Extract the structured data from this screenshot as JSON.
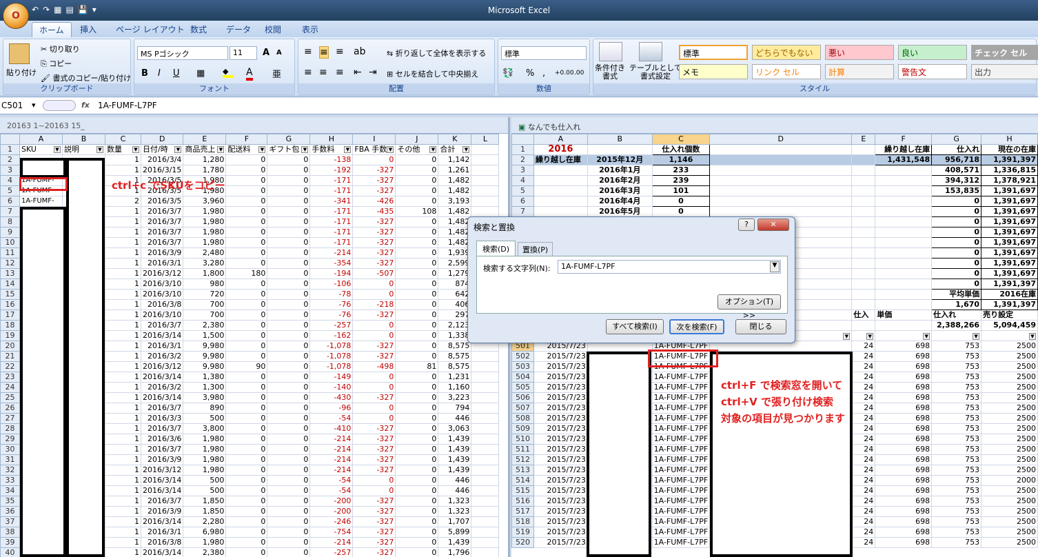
{
  "app_title": "Microsoft Excel",
  "office_button": "O",
  "qat": [
    "↶",
    "↷",
    "▦",
    "▤",
    "💾",
    "▾"
  ],
  "ribbon_tabs": [
    "ホーム",
    "挿入",
    "ページ レイアウト",
    "数式",
    "データ",
    "校閲",
    "表示"
  ],
  "clipboard": {
    "paste": "貼り付け",
    "cut": "切り取り",
    "copy": "コピー",
    "format_painter": "書式のコピー/貼り付け",
    "label": "クリップボード"
  },
  "font": {
    "name": "MS Pゴシック",
    "size": "11",
    "label": "フォント",
    "bold": "B",
    "italic": "I",
    "underline": "U",
    "grow": "A",
    "shrink": "A",
    "phonetic": "亜"
  },
  "alignment": {
    "wrap": "折り返して全体を表示する",
    "merge": "セルを結合して中央揃え",
    "label": "配置"
  },
  "number": {
    "format": "標準",
    "label": "数値",
    "percent": "%",
    "comma": ",",
    "inc": "+0.00",
    "dec": ".00"
  },
  "styles": {
    "conditional": "条件付き\n書式",
    "table": "テーブルとして\n書式設定",
    "label": "スタイル",
    "cells": [
      "標準",
      "どちらでもない",
      "悪い",
      "良い",
      "チェック セル",
      "メモ",
      "リンク セル",
      "計算",
      "警告文",
      "出力"
    ]
  },
  "formula_bar": {
    "name_box": "C501",
    "fx": "fx",
    "content": "1A-FUMF-L7PF"
  },
  "left_window": {
    "title": "20163 1~20163 15_",
    "cols": [
      "A",
      "B",
      "C",
      "D",
      "E",
      "F",
      "G",
      "H",
      "I",
      "J",
      "K",
      "L"
    ],
    "headers": [
      "SKU",
      "説明",
      "数量",
      "日付/時",
      "商品売上",
      "配送料",
      "ギフト包",
      "手数料",
      "FBA 手数",
      "その他",
      "合計"
    ],
    "rows": [
      [
        "2",
        "",
        "",
        "1",
        "2016/3/4",
        "1,280",
        "0",
        "0",
        "-138",
        "0",
        "0",
        "1,142"
      ],
      [
        "3",
        "",
        "",
        "1",
        "2016/3/15",
        "1,780",
        "0",
        "0",
        "-192",
        "-327",
        "0",
        "1,261"
      ],
      [
        "4",
        "1A-FUMF-",
        "",
        "1",
        "2016/3/5",
        "1,980",
        "0",
        "0",
        "-171",
        "-327",
        "0",
        "1,482"
      ],
      [
        "5",
        "1A-FUMF-",
        "",
        "1",
        "2016/3/5",
        "1,980",
        "0",
        "0",
        "-171",
        "-327",
        "0",
        "1,482"
      ],
      [
        "6",
        "1A-FUMF-",
        "",
        "2",
        "2016/3/5",
        "3,960",
        "0",
        "0",
        "-341",
        "-426",
        "0",
        "3,193"
      ],
      [
        "7",
        "",
        "",
        "1",
        "2016/3/7",
        "1,980",
        "0",
        "0",
        "-171",
        "-435",
        "108",
        "1,482"
      ],
      [
        "8",
        "",
        "",
        "1",
        "2016/3/7",
        "1,980",
        "0",
        "0",
        "-171",
        "-327",
        "0",
        "1,482"
      ],
      [
        "9",
        "",
        "",
        "1",
        "2016/3/7",
        "1,980",
        "0",
        "0",
        "-171",
        "-327",
        "0",
        "1,482"
      ],
      [
        "10",
        "",
        "",
        "1",
        "2016/3/7",
        "1,980",
        "0",
        "0",
        "-171",
        "-327",
        "0",
        "1,482"
      ],
      [
        "11",
        "",
        "",
        "1",
        "2016/3/9",
        "2,480",
        "0",
        "0",
        "-214",
        "-327",
        "0",
        "1,939"
      ],
      [
        "12",
        "",
        "",
        "1",
        "2016/3/1",
        "3,280",
        "0",
        "0",
        "-354",
        "-327",
        "0",
        "2,599"
      ],
      [
        "13",
        "",
        "",
        "1",
        "2016/3/12",
        "1,800",
        "180",
        "0",
        "-194",
        "-507",
        "0",
        "1,279"
      ],
      [
        "14",
        "",
        "",
        "1",
        "2016/3/10",
        "980",
        "0",
        "0",
        "-106",
        "0",
        "0",
        "874"
      ],
      [
        "15",
        "",
        "",
        "1",
        "2016/3/10",
        "720",
        "0",
        "0",
        "-78",
        "0",
        "0",
        "642"
      ],
      [
        "16",
        "",
        "",
        "1",
        "2016/3/8",
        "700",
        "0",
        "0",
        "-76",
        "-218",
        "0",
        "406"
      ],
      [
        "17",
        "",
        "",
        "1",
        "2016/3/10",
        "700",
        "0",
        "0",
        "-76",
        "-327",
        "0",
        "297"
      ],
      [
        "18",
        "",
        "",
        "1",
        "2016/3/7",
        "2,380",
        "0",
        "0",
        "-257",
        "0",
        "0",
        "2,123"
      ],
      [
        "19",
        "",
        "",
        "1",
        "2016/3/14",
        "1,500",
        "0",
        "0",
        "-162",
        "0",
        "0",
        "1,338"
      ],
      [
        "20",
        "",
        "",
        "1",
        "2016/3/1",
        "9,980",
        "0",
        "0",
        "-1,078",
        "-327",
        "0",
        "8,575"
      ],
      [
        "21",
        "",
        "",
        "1",
        "2016/3/2",
        "9,980",
        "0",
        "0",
        "-1,078",
        "-327",
        "0",
        "8,575"
      ],
      [
        "22",
        "",
        "",
        "1",
        "2016/3/12",
        "9,980",
        "90",
        "0",
        "-1,078",
        "-498",
        "81",
        "8,575"
      ],
      [
        "23",
        "",
        "",
        "1",
        "2016/3/14",
        "1,380",
        "0",
        "0",
        "-149",
        "0",
        "0",
        "1,231"
      ],
      [
        "24",
        "",
        "",
        "1",
        "2016/3/2",
        "1,300",
        "0",
        "0",
        "-140",
        "0",
        "0",
        "1,160"
      ],
      [
        "25",
        "",
        "",
        "1",
        "2016/3/14",
        "3,980",
        "0",
        "0",
        "-430",
        "-327",
        "0",
        "3,223"
      ],
      [
        "26",
        "",
        "",
        "1",
        "2016/3/7",
        "890",
        "0",
        "0",
        "-96",
        "0",
        "0",
        "794"
      ],
      [
        "27",
        "",
        "",
        "1",
        "2016/3/3",
        "500",
        "0",
        "0",
        "-54",
        "0",
        "0",
        "446"
      ],
      [
        "28",
        "",
        "",
        "1",
        "2016/3/7",
        "3,800",
        "0",
        "0",
        "-410",
        "-327",
        "0",
        "3,063"
      ],
      [
        "29",
        "",
        "",
        "1",
        "2016/3/6",
        "1,980",
        "0",
        "0",
        "-214",
        "-327",
        "0",
        "1,439"
      ],
      [
        "30",
        "",
        "",
        "1",
        "2016/3/7",
        "1,980",
        "0",
        "0",
        "-214",
        "-327",
        "0",
        "1,439"
      ],
      [
        "31",
        "",
        "",
        "1",
        "2016/3/9",
        "1,980",
        "0",
        "0",
        "-214",
        "-327",
        "0",
        "1,439"
      ],
      [
        "32",
        "",
        "",
        "1",
        "2016/3/12",
        "1,980",
        "0",
        "0",
        "-214",
        "-327",
        "0",
        "1,439"
      ],
      [
        "33",
        "",
        "",
        "1",
        "2016/3/14",
        "500",
        "0",
        "0",
        "-54",
        "0",
        "0",
        "446"
      ],
      [
        "34",
        "",
        "",
        "1",
        "2016/3/14",
        "500",
        "0",
        "0",
        "-54",
        "0",
        "0",
        "446"
      ],
      [
        "35",
        "",
        "",
        "1",
        "2016/3/7",
        "1,850",
        "0",
        "0",
        "-200",
        "-327",
        "0",
        "1,323"
      ],
      [
        "36",
        "",
        "",
        "1",
        "2016/3/9",
        "1,850",
        "0",
        "0",
        "-200",
        "-327",
        "0",
        "1,323"
      ],
      [
        "37",
        "",
        "",
        "1",
        "2016/3/14",
        "2,280",
        "0",
        "0",
        "-246",
        "-327",
        "0",
        "1,707"
      ],
      [
        "38",
        "",
        "",
        "1",
        "2016/3/1",
        "6,980",
        "0",
        "0",
        "-754",
        "-327",
        "0",
        "5,899"
      ],
      [
        "39",
        "",
        "",
        "1",
        "2016/3/8",
        "1,980",
        "0",
        "0",
        "-214",
        "-327",
        "0",
        "1,439"
      ],
      [
        "40",
        "",
        "",
        "1",
        "2016/3/14",
        "2,380",
        "0",
        "0",
        "-257",
        "-327",
        "0",
        "1,796"
      ]
    ]
  },
  "right_window": {
    "title": "なんでも仕入れ",
    "cols": [
      "A",
      "B",
      "C",
      "D",
      "E",
      "F",
      "G",
      "H"
    ],
    "top_rows": [
      [
        "1",
        "2016",
        "",
        "仕入れ個数",
        "",
        "",
        "繰り越し在庫",
        "仕入れ",
        "現在の在庫"
      ],
      [
        "2",
        "繰り越し在庫",
        "2015年12月",
        "1,146",
        "",
        "",
        "1,431,548",
        "956,718",
        "1,391,397"
      ],
      [
        "3",
        "",
        "2016年1月",
        "233",
        "",
        "",
        "",
        "408,571",
        "1,336,815"
      ],
      [
        "4",
        "",
        "2016年2月",
        "239",
        "",
        "",
        "",
        "394,312",
        "1,378,921"
      ],
      [
        "5",
        "",
        "2016年3月",
        "101",
        "",
        "",
        "",
        "153,835",
        "1,391,697"
      ],
      [
        "6",
        "",
        "2016年4月",
        "0",
        "",
        "",
        "",
        "0",
        "1,391,697"
      ],
      [
        "7",
        "",
        "2016年5月",
        "0",
        "",
        "",
        "",
        "0",
        "1,391,697"
      ],
      [
        "8",
        "",
        "",
        "0",
        "",
        "",
        "",
        "0",
        "1,391,697"
      ],
      [
        "9",
        "",
        "",
        "",
        "",
        "",
        "",
        "0",
        "1,391,697"
      ],
      [
        "10",
        "",
        "",
        "",
        "",
        "",
        "",
        "0",
        "1,391,697"
      ],
      [
        "11",
        "",
        "",
        "",
        "",
        "",
        "",
        "0",
        "1,391,697"
      ],
      [
        "12",
        "",
        "",
        "",
        "",
        "",
        "",
        "0",
        "1,391,697"
      ],
      [
        "13",
        "",
        "",
        "",
        "",
        "",
        "",
        "0",
        "1,391,697"
      ],
      [
        "14",
        "",
        "",
        "",
        "",
        "",
        "",
        "0",
        "1,391,397"
      ],
      [
        "15",
        "",
        "",
        "",
        "",
        "",
        "",
        "平均単価",
        "2016在庫"
      ],
      [
        "16",
        "",
        "",
        "",
        "",
        "",
        "",
        "1,670",
        "1,391,397"
      ],
      [
        "17",
        "",
        "",
        "",
        "",
        "仕入",
        "単価",
        "仕入れ",
        "売り設定"
      ],
      [
        "18",
        "",
        "",
        "",
        "",
        "",
        "",
        "2,388,266",
        "5,094,459"
      ]
    ],
    "data_rows": [
      [
        "501",
        "2015/7/23",
        "",
        "1A-FUMF-L7PF",
        "",
        "24",
        "698",
        "753",
        "2500"
      ],
      [
        "502",
        "2015/7/23",
        "",
        "1A-FUMF-L7PF",
        "",
        "24",
        "698",
        "753",
        "2500"
      ],
      [
        "503",
        "2015/7/23",
        "",
        "1A-FUMF-L7PF",
        "",
        "24",
        "698",
        "753",
        "2500"
      ],
      [
        "504",
        "2015/7/23",
        "",
        "1A-FUMF-L7PF",
        "",
        "24",
        "698",
        "753",
        "2500"
      ],
      [
        "505",
        "2015/7/23",
        "",
        "1A-FUMF-L7PF",
        "",
        "24",
        "698",
        "753",
        "2500"
      ],
      [
        "506",
        "2015/7/23",
        "",
        "1A-FUMF-L7PF",
        "",
        "24",
        "698",
        "753",
        "2500"
      ],
      [
        "507",
        "2015/7/23",
        "",
        "1A-FUMF-L7PF",
        "",
        "24",
        "698",
        "753",
        "2500"
      ],
      [
        "508",
        "2015/7/23",
        "",
        "1A-FUMF-L7PF",
        "",
        "24",
        "698",
        "753",
        "2500"
      ],
      [
        "509",
        "2015/7/23",
        "",
        "1A-FUMF-L7PF",
        "",
        "24",
        "698",
        "753",
        "2500"
      ],
      [
        "510",
        "2015/7/23",
        "",
        "1A-FUMF-L7PF",
        "",
        "24",
        "698",
        "753",
        "2500"
      ],
      [
        "511",
        "2015/7/23",
        "",
        "1A-FUMF-L7PF",
        "",
        "24",
        "698",
        "753",
        "2500"
      ],
      [
        "512",
        "2015/7/23",
        "",
        "1A-FUMF-L7PF",
        "",
        "24",
        "698",
        "753",
        "2500"
      ],
      [
        "513",
        "2015/7/23",
        "",
        "1A-FUMF-L7PF",
        "",
        "24",
        "698",
        "753",
        "2500"
      ],
      [
        "514",
        "2015/7/23",
        "",
        "1A-FUMF-L7PF",
        "",
        "24",
        "698",
        "753",
        "2000"
      ],
      [
        "515",
        "2015/7/23",
        "",
        "1A-FUMF-L7PF",
        "",
        "24",
        "698",
        "753",
        "2500"
      ],
      [
        "516",
        "2015/7/23",
        "",
        "1A-FUMF-L7PF",
        "",
        "24",
        "698",
        "753",
        "2500"
      ],
      [
        "517",
        "2015/7/23",
        "",
        "1A-FUMF-L7PF",
        "",
        "24",
        "698",
        "753",
        "2500"
      ],
      [
        "518",
        "2015/7/23",
        "",
        "1A-FUMF-L7PF",
        "",
        "24",
        "698",
        "753",
        "2500"
      ],
      [
        "519",
        "2015/7/23",
        "",
        "1A-FUMF-L7PF",
        "",
        "24",
        "698",
        "753",
        "2500"
      ],
      [
        "520",
        "2015/7/23",
        "",
        "1A-FUMF-L7PF",
        "",
        "24",
        "698",
        "753",
        "2500"
      ]
    ]
  },
  "dialog": {
    "title": "検索と置換",
    "tab_find": "検索(D)",
    "tab_replace": "置換(P)",
    "find_label": "検索する文字列(N):",
    "find_value": "1A-FUMF-L7PF",
    "options": "オプション(T) >>",
    "find_all": "すべて検索(I)",
    "find_next": "次を検索(F)",
    "close": "閉じる",
    "help": "?",
    "close_x": "✕"
  },
  "annotations": {
    "left": "ctrl+c でSKUをコピー",
    "right1": "ctrl+F で検索窓を開いて",
    "right2": "ctrl+V で張り付け検索",
    "right3": "対象の項目が見つかります"
  }
}
